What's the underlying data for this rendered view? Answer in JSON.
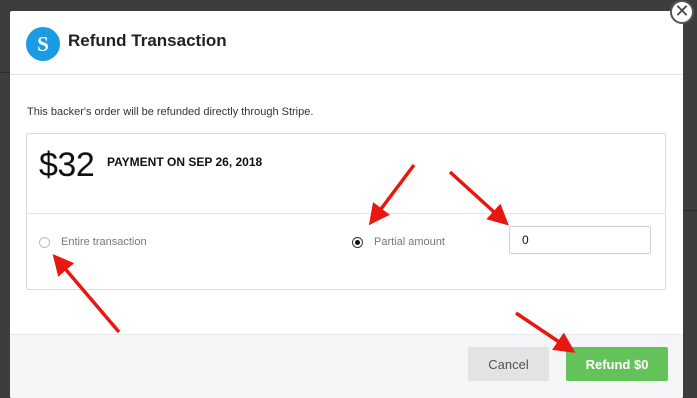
{
  "modal": {
    "logo_letter": "S",
    "title": "Refund Transaction",
    "info_text": "This backer's order will be refunded directly through Stripe.",
    "close_symbol": "✕"
  },
  "payment": {
    "amount": "$32",
    "date_label": "PAYMENT ON SEP 26, 2018"
  },
  "refund_options": {
    "entire": {
      "label": "Entire transaction",
      "selected": false
    },
    "partial": {
      "label": "Partial amount",
      "selected": true
    },
    "partial_amount_value": "0"
  },
  "footer": {
    "cancel_label": "Cancel",
    "refund_label": "Refund $0"
  },
  "colors": {
    "stripe_blue": "#1a9ce4",
    "refund_green": "#63c35a",
    "annotation_red": "#e8170f"
  }
}
